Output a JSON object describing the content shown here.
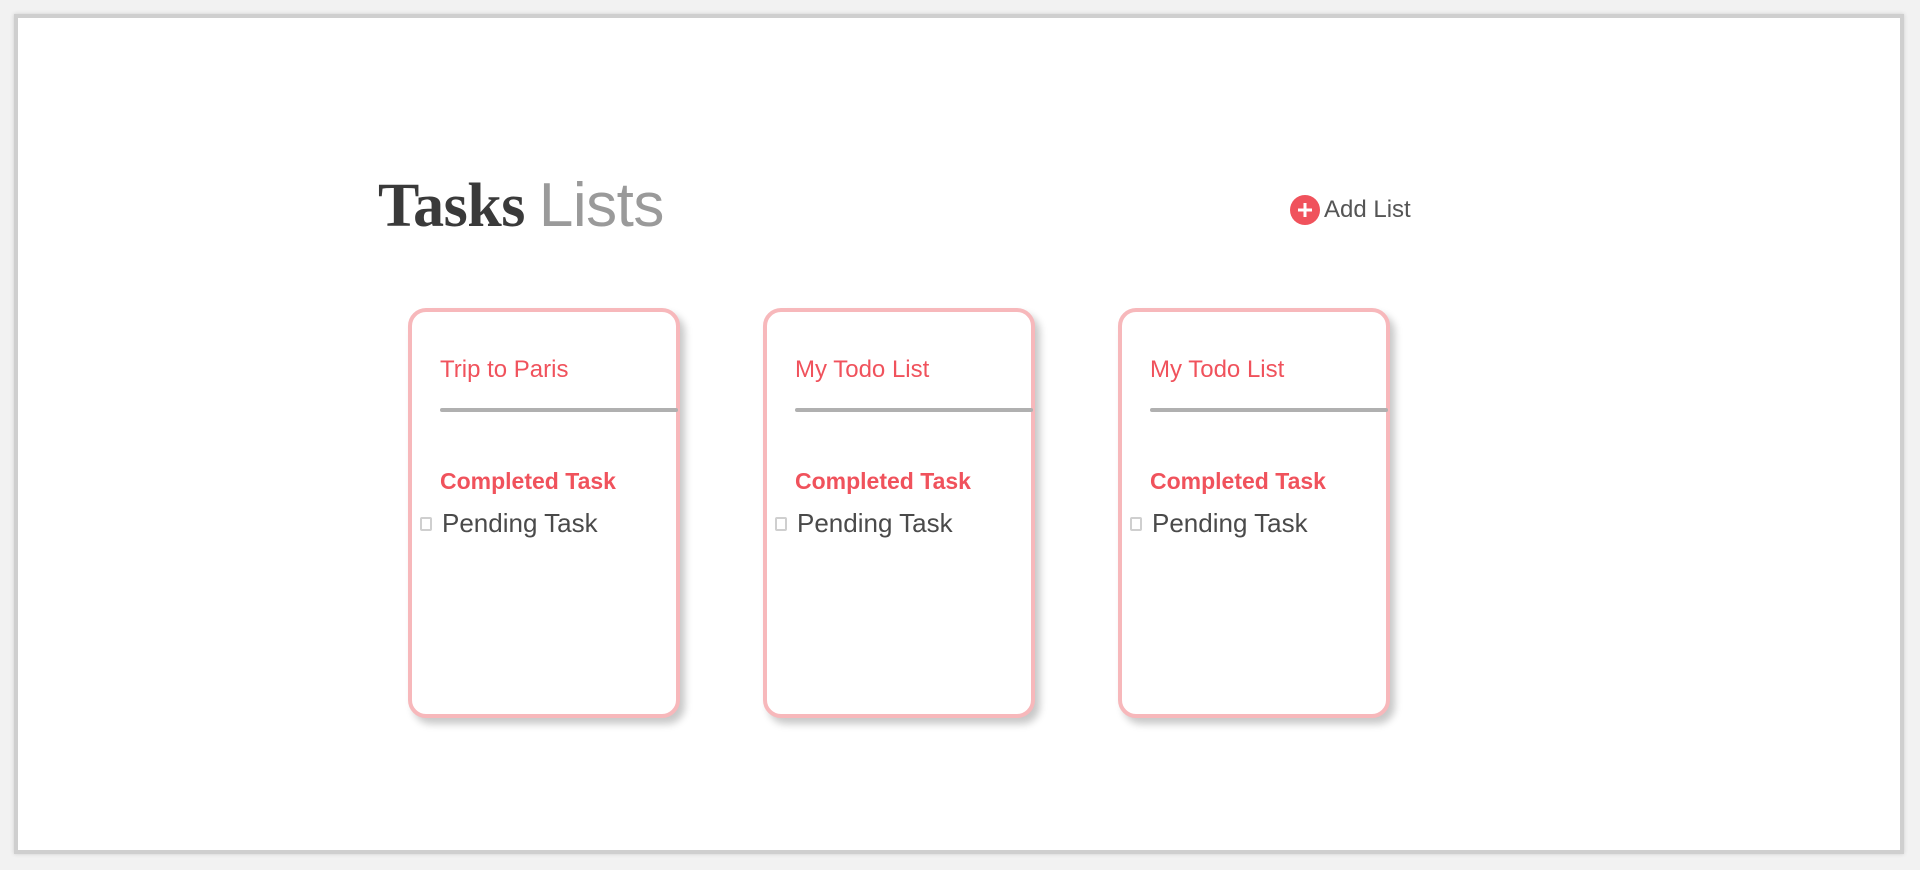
{
  "header": {
    "title_strong": "Tasks",
    "title_light": "Lists",
    "add_list_label": "Add List"
  },
  "colors": {
    "accent": "#f0525c",
    "card_border": "#f7b8bb",
    "divider": "#b0b0b0",
    "title_dark": "#3a3a3a",
    "title_light": "#9a9a9a"
  },
  "lists": [
    {
      "title": "Trip to Paris",
      "completed_task": "Completed Task",
      "pending_task": "Pending Task"
    },
    {
      "title": "My Todo List",
      "completed_task": "Completed Task",
      "pending_task": "Pending Task"
    },
    {
      "title": "My Todo List",
      "completed_task": "Completed Task",
      "pending_task": "Pending Task"
    }
  ]
}
